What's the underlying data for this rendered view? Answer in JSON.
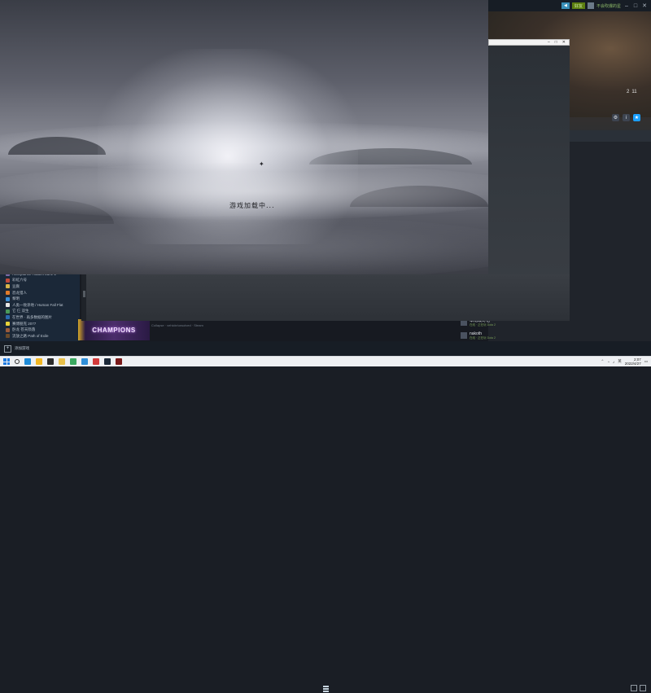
{
  "steam": {
    "titlebar": {
      "friends_label": "好友",
      "username": "不会吹爆的星",
      "minimize": "–",
      "maximize": "□",
      "close": "✕"
    },
    "hero_stats": [
      "2",
      "11"
    ],
    "hero_icons": [
      "gear-icon",
      "info-icon",
      "star-icon"
    ],
    "friends": [
      {
        "name": "华南战诗格",
        "status": "在线 · 正在玩 Dota 2"
      },
      {
        "name": "nakoth",
        "status": "在线 · 正在玩 Dota 2"
      }
    ],
    "library_items": [
      {
        "label": "Acceptance Hidden Lane 2",
        "color": "#7a6aa8"
      },
      {
        "label": "彩虹六号",
        "color": "#c04a3a"
      },
      {
        "label": "豆腐",
        "color": "#d6b44a"
      },
      {
        "label": "恐龙猎人",
        "color": "#e07b2a"
      },
      {
        "label": "黎明",
        "color": "#3a8fd8"
      },
      {
        "label": "人类一败涂地 / Human Fall Flat",
        "color": "#e8e8e8"
      },
      {
        "label": "它 仨 双生",
        "color": "#4a9a5a"
      },
      {
        "label": "在世界 · 再多数据的图片",
        "color": "#2a6ab0"
      },
      {
        "label": "赛博朋克 2077",
        "color": "#e8d43a"
      },
      {
        "label": "卧龙 苍天陨落",
        "color": "#9a5a3a"
      },
      {
        "label": "流放之路 Path of Exile",
        "color": "#6a4a2a"
      }
    ],
    "add_game_label": "添加游戏",
    "game_art_title": "CHAMPIONS",
    "dim_text": "Collapse · vehicle/unsolved · Steam"
  },
  "game_window": {
    "loading_text": "游戏加载中..."
  },
  "taskbar": {
    "apps": [
      {
        "name": "edge-icon",
        "color": "#1e8bd8"
      },
      {
        "name": "file-explorer-icon",
        "color": "#f2b724"
      },
      {
        "name": "terminal-icon",
        "color": "#2b2b2b"
      },
      {
        "name": "folder-icon",
        "color": "#e8c04a"
      },
      {
        "name": "app-green-icon",
        "color": "#3aa860"
      },
      {
        "name": "chrome-icon",
        "color": "#2f8fd9"
      },
      {
        "name": "netease-icon",
        "color": "#d33a3a"
      },
      {
        "name": "steam-icon",
        "color": "#1b2838"
      },
      {
        "name": "game-icon",
        "color": "#7a1a1a"
      }
    ],
    "lang": "英",
    "time": "2:07",
    "date": "2022/4/27"
  }
}
